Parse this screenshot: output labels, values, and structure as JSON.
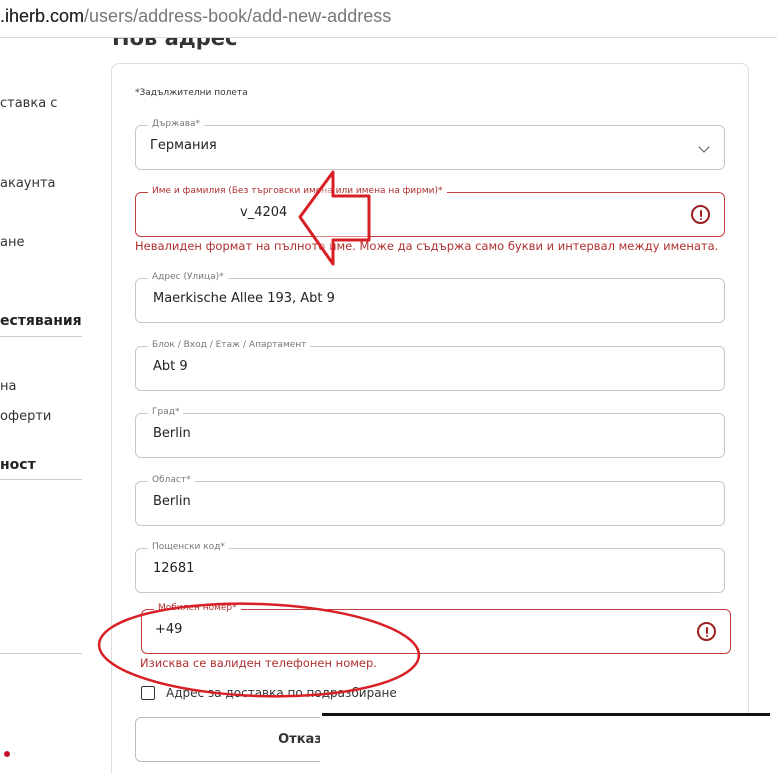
{
  "browser": {
    "url_host": ".iherb.com",
    "url_path": "/users/address-book/add-new-address"
  },
  "sidebar": {
    "items": [
      {
        "label": "ставка с"
      },
      {
        "label": "акаунта"
      },
      {
        "label": "ане"
      }
    ],
    "heading_1": "естявания",
    "items_2": [
      {
        "label": "на"
      },
      {
        "label": "оферти"
      }
    ],
    "heading_2": "ност"
  },
  "page_title": "Нов адрес",
  "form": {
    "required_note": "*Задължителни полета",
    "country": {
      "label": "Държава*",
      "value": "Германия"
    },
    "full_name": {
      "label": "Име и фамилия (Без търговски имена или имена на фирми)*",
      "value": "v_4204",
      "error": "Невалиден формат на пълното име. Може да съдържа само букви и интервал между имената."
    },
    "street": {
      "label": "Адрес (Улица)*",
      "value": "Maerkische Allee 193, Abt 9"
    },
    "block": {
      "label": "Блок / Вход / Етаж / Апартамент",
      "value": "Abt 9"
    },
    "city": {
      "label": "Град*",
      "value": "Berlin"
    },
    "region": {
      "label": "Област*",
      "value": "Berlin"
    },
    "postal_code": {
      "label": "Пощенски код*",
      "value": "12681"
    },
    "mobile": {
      "label": "Мобилен номер*",
      "value": "+49",
      "error": "Изисква се валиден телефонен номер."
    },
    "default_address_label": "Адрес за доставка по подразбиране",
    "cancel_label": "Отказ"
  },
  "colors": {
    "error": "#b03030",
    "annotation": "#d81f26",
    "brand_dot": "#c8102e"
  },
  "icons": [
    "chevron-down-icon",
    "error-icon",
    "error-icon"
  ]
}
